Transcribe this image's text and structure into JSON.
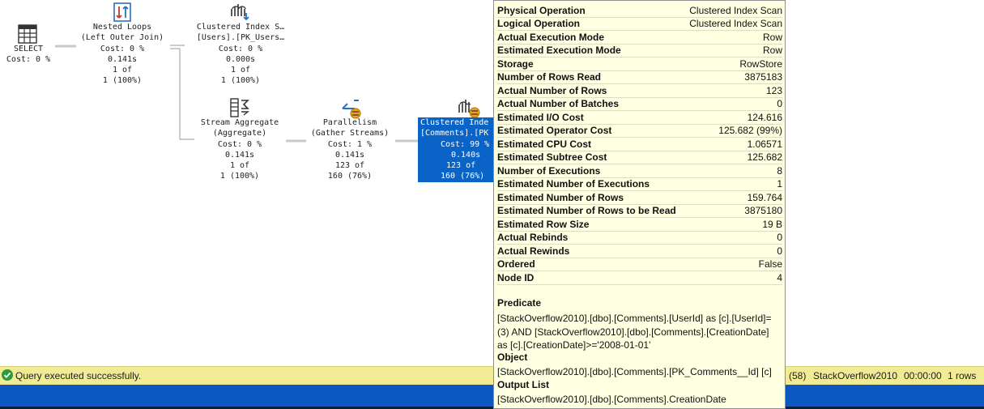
{
  "plan": {
    "nodes": [
      {
        "id": "select",
        "lines": [
          "SELECT",
          "Cost: 0 %"
        ],
        "icon": "select-icon"
      },
      {
        "id": "nested-loops",
        "lines": [
          "Nested Loops",
          "(Left Outer Join)",
          "Cost: 0 %",
          "0.141s",
          "1 of",
          "1 (100%)"
        ],
        "icon": "nested-loops-icon"
      },
      {
        "id": "clustered-index-scan-users",
        "lines": [
          "Clustered Index S…",
          "[Users].[PK_Users…",
          "Cost: 0 %",
          "0.000s",
          "1 of",
          "1 (100%)"
        ],
        "icon": "clustered-index-scan-icon"
      },
      {
        "id": "stream-aggregate",
        "lines": [
          "Stream Aggregate",
          "(Aggregate)",
          "Cost: 0 %",
          "0.141s",
          "1 of",
          "1 (100%)"
        ],
        "icon": "stream-aggregate-icon"
      },
      {
        "id": "parallelism",
        "lines": [
          "Parallelism",
          "(Gather Streams)",
          "Cost: 1 %",
          "0.141s",
          "123 of",
          "160 (76%)"
        ],
        "icon": "parallelism-icon"
      },
      {
        "id": "clustered-index-scan-comments",
        "lines": [
          "Clustered Inde",
          "[Comments].[PK",
          "Cost: 99 %",
          "0.140s",
          "123 of",
          "160 (76%)"
        ],
        "icon": "clustered-index-scan-parallel-icon"
      }
    ]
  },
  "tooltip": {
    "properties": [
      {
        "name": "Physical Operation",
        "value": "Clustered Index Scan"
      },
      {
        "name": "Logical Operation",
        "value": "Clustered Index Scan"
      },
      {
        "name": "Actual Execution Mode",
        "value": "Row"
      },
      {
        "name": "Estimated Execution Mode",
        "value": "Row"
      },
      {
        "name": "Storage",
        "value": "RowStore"
      },
      {
        "name": "Number of Rows Read",
        "value": "3875183"
      },
      {
        "name": "Actual Number of Rows",
        "value": "123"
      },
      {
        "name": "Actual Number of Batches",
        "value": "0"
      },
      {
        "name": "Estimated I/O Cost",
        "value": "124.616"
      },
      {
        "name": "Estimated Operator Cost",
        "value": "125.682 (99%)"
      },
      {
        "name": "Estimated CPU Cost",
        "value": "1.06571"
      },
      {
        "name": "Estimated Subtree Cost",
        "value": "125.682"
      },
      {
        "name": "Number of Executions",
        "value": "8"
      },
      {
        "name": "Estimated Number of Executions",
        "value": "1"
      },
      {
        "name": "Estimated Number of Rows",
        "value": "159.764"
      },
      {
        "name": "Estimated Number of Rows to be Read",
        "value": "3875180"
      },
      {
        "name": "Estimated Row Size",
        "value": "19 B"
      },
      {
        "name": "Actual Rebinds",
        "value": "0"
      },
      {
        "name": "Actual Rewinds",
        "value": "0"
      },
      {
        "name": "Ordered",
        "value": "False"
      },
      {
        "name": "Node ID",
        "value": "4"
      }
    ],
    "predicate_label": "Predicate",
    "predicate_lines": [
      "[StackOverflow2010].[dbo].[Comments].[UserId] as [c].[UserId]=",
      "(3) AND [StackOverflow2010].[dbo].[Comments].[CreationDate]",
      "as [c].[CreationDate]>='2008-01-01'"
    ],
    "object_label": "Object",
    "object_value": "[StackOverflow2010].[dbo].[Comments].[PK_Comments__Id] [c]",
    "output_label": "Output List",
    "output_value": "[StackOverflow2010].[dbo].[Comments].CreationDate"
  },
  "status": {
    "message": "Query executed successfully.",
    "session": "(58)",
    "database": "StackOverflow2010",
    "elapsed": "00:00:00",
    "rows": "1 rows",
    "success_color": "#2e9b3a",
    "bar_color": "#f1eb95",
    "selection_color": "#0a64c8"
  }
}
